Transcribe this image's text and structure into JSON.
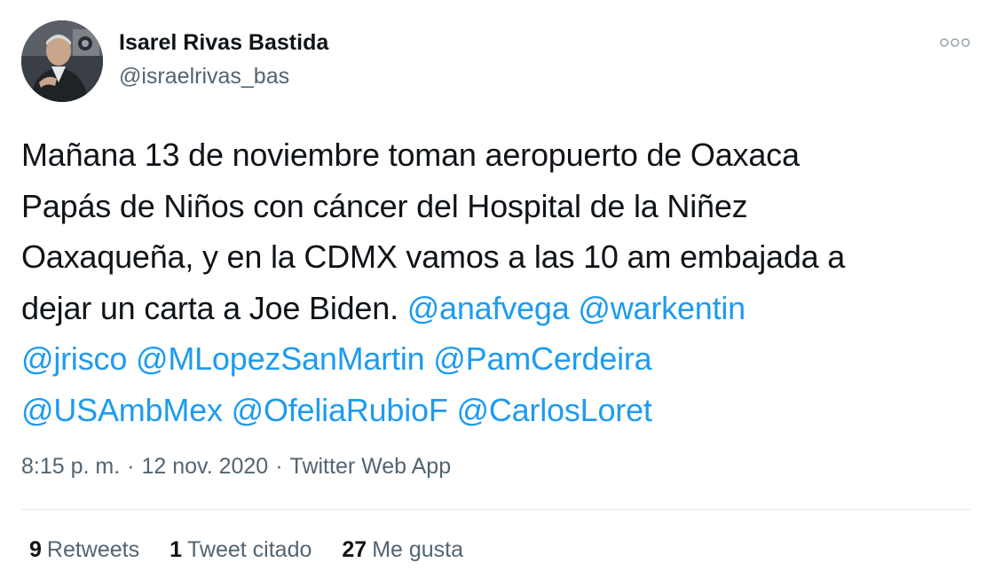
{
  "user": {
    "display_name": "Isarel Rivas Bastida",
    "handle": "@israelrivas_bas",
    "avatar_icon": "profile-photo"
  },
  "more_icon": "more-options-icon",
  "tweet": {
    "line1": "Mañana 13 de noviembre toman aeropuerto de Oaxaca",
    "line2": "Papás de Niños con cáncer  del Hospital de la Niñez",
    "line3": "Oaxaqueña, y en la CDMX vamos a las 10 am embajada a",
    "line4_text": "dejar un carta a Joe Biden. ",
    "mentions": [
      "@anafvega",
      "@warkentin",
      "@jrisco",
      "@MLopezSanMartin",
      "@PamCerdeira",
      "@USAmbMex",
      "@OfeliaRubioF",
      "@CarlosLoret"
    ]
  },
  "meta": {
    "time": "8:15 p. m.",
    "separator": "·",
    "date": "12 nov. 2020",
    "source": "Twitter Web App"
  },
  "stats": {
    "retweets_count": "9",
    "retweets_label": "Retweets",
    "quotes_count": "1",
    "quotes_label": "Tweet citado",
    "likes_count": "27",
    "likes_label": "Me gusta"
  },
  "colors": {
    "mention": "#1d9bf0",
    "secondary_text": "#536471",
    "primary_text": "#0f1419",
    "divider": "#e1e8ed"
  }
}
